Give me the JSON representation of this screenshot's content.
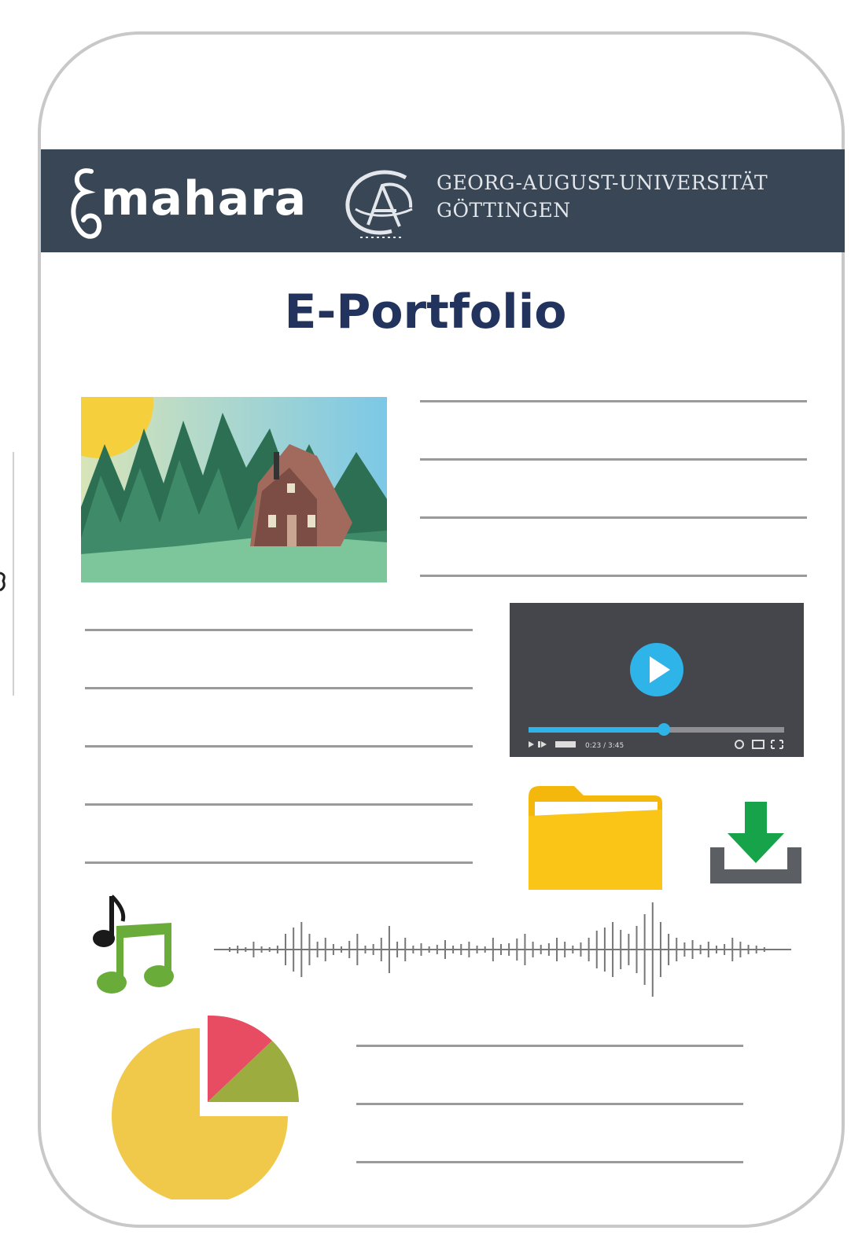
{
  "brand": {
    "product": "mahara",
    "university_line1": "GEORG-AUGUST-UNIVERSITÄT",
    "university_line2": "GÖTTINGEN"
  },
  "page": {
    "title": "E-Portfolio"
  },
  "video_player": {
    "time_display": "0:23 / 3:45",
    "progress_fraction": 0.53,
    "icons": [
      "play-icon",
      "next-icon",
      "volume-icon",
      "settings-icon",
      "window-icon",
      "fullscreen-icon"
    ]
  },
  "colors": {
    "banner": "#394655",
    "title": "#22335e",
    "play_button": "#2eb4e8",
    "folder": "#fbc518",
    "download_arrow": "#17a34a",
    "music_note": "#6aac3a",
    "pie_main": "#f1c94a",
    "pie_red": "#e84c63",
    "pie_green": "#9cac3e"
  },
  "icons": [
    "landscape-image",
    "video-thumbnail",
    "folder-icon",
    "download-icon",
    "music-notes-icon",
    "audio-waveform",
    "pie-chart-icon"
  ]
}
